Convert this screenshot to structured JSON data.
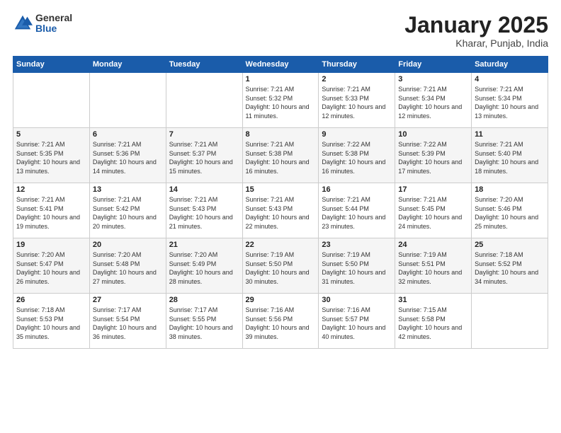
{
  "header": {
    "logo_general": "General",
    "logo_blue": "Blue",
    "month_title": "January 2025",
    "location": "Kharar, Punjab, India"
  },
  "days_of_week": [
    "Sunday",
    "Monday",
    "Tuesday",
    "Wednesday",
    "Thursday",
    "Friday",
    "Saturday"
  ],
  "weeks": [
    [
      {
        "day": "",
        "sunrise": "",
        "sunset": "",
        "daylight": ""
      },
      {
        "day": "",
        "sunrise": "",
        "sunset": "",
        "daylight": ""
      },
      {
        "day": "",
        "sunrise": "",
        "sunset": "",
        "daylight": ""
      },
      {
        "day": "1",
        "sunrise": "Sunrise: 7:21 AM",
        "sunset": "Sunset: 5:32 PM",
        "daylight": "Daylight: 10 hours and 11 minutes."
      },
      {
        "day": "2",
        "sunrise": "Sunrise: 7:21 AM",
        "sunset": "Sunset: 5:33 PM",
        "daylight": "Daylight: 10 hours and 12 minutes."
      },
      {
        "day": "3",
        "sunrise": "Sunrise: 7:21 AM",
        "sunset": "Sunset: 5:34 PM",
        "daylight": "Daylight: 10 hours and 12 minutes."
      },
      {
        "day": "4",
        "sunrise": "Sunrise: 7:21 AM",
        "sunset": "Sunset: 5:34 PM",
        "daylight": "Daylight: 10 hours and 13 minutes."
      }
    ],
    [
      {
        "day": "5",
        "sunrise": "Sunrise: 7:21 AM",
        "sunset": "Sunset: 5:35 PM",
        "daylight": "Daylight: 10 hours and 13 minutes."
      },
      {
        "day": "6",
        "sunrise": "Sunrise: 7:21 AM",
        "sunset": "Sunset: 5:36 PM",
        "daylight": "Daylight: 10 hours and 14 minutes."
      },
      {
        "day": "7",
        "sunrise": "Sunrise: 7:21 AM",
        "sunset": "Sunset: 5:37 PM",
        "daylight": "Daylight: 10 hours and 15 minutes."
      },
      {
        "day": "8",
        "sunrise": "Sunrise: 7:21 AM",
        "sunset": "Sunset: 5:38 PM",
        "daylight": "Daylight: 10 hours and 16 minutes."
      },
      {
        "day": "9",
        "sunrise": "Sunrise: 7:22 AM",
        "sunset": "Sunset: 5:38 PM",
        "daylight": "Daylight: 10 hours and 16 minutes."
      },
      {
        "day": "10",
        "sunrise": "Sunrise: 7:22 AM",
        "sunset": "Sunset: 5:39 PM",
        "daylight": "Daylight: 10 hours and 17 minutes."
      },
      {
        "day": "11",
        "sunrise": "Sunrise: 7:21 AM",
        "sunset": "Sunset: 5:40 PM",
        "daylight": "Daylight: 10 hours and 18 minutes."
      }
    ],
    [
      {
        "day": "12",
        "sunrise": "Sunrise: 7:21 AM",
        "sunset": "Sunset: 5:41 PM",
        "daylight": "Daylight: 10 hours and 19 minutes."
      },
      {
        "day": "13",
        "sunrise": "Sunrise: 7:21 AM",
        "sunset": "Sunset: 5:42 PM",
        "daylight": "Daylight: 10 hours and 20 minutes."
      },
      {
        "day": "14",
        "sunrise": "Sunrise: 7:21 AM",
        "sunset": "Sunset: 5:43 PM",
        "daylight": "Daylight: 10 hours and 21 minutes."
      },
      {
        "day": "15",
        "sunrise": "Sunrise: 7:21 AM",
        "sunset": "Sunset: 5:43 PM",
        "daylight": "Daylight: 10 hours and 22 minutes."
      },
      {
        "day": "16",
        "sunrise": "Sunrise: 7:21 AM",
        "sunset": "Sunset: 5:44 PM",
        "daylight": "Daylight: 10 hours and 23 minutes."
      },
      {
        "day": "17",
        "sunrise": "Sunrise: 7:21 AM",
        "sunset": "Sunset: 5:45 PM",
        "daylight": "Daylight: 10 hours and 24 minutes."
      },
      {
        "day": "18",
        "sunrise": "Sunrise: 7:20 AM",
        "sunset": "Sunset: 5:46 PM",
        "daylight": "Daylight: 10 hours and 25 minutes."
      }
    ],
    [
      {
        "day": "19",
        "sunrise": "Sunrise: 7:20 AM",
        "sunset": "Sunset: 5:47 PM",
        "daylight": "Daylight: 10 hours and 26 minutes."
      },
      {
        "day": "20",
        "sunrise": "Sunrise: 7:20 AM",
        "sunset": "Sunset: 5:48 PM",
        "daylight": "Daylight: 10 hours and 27 minutes."
      },
      {
        "day": "21",
        "sunrise": "Sunrise: 7:20 AM",
        "sunset": "Sunset: 5:49 PM",
        "daylight": "Daylight: 10 hours and 28 minutes."
      },
      {
        "day": "22",
        "sunrise": "Sunrise: 7:19 AM",
        "sunset": "Sunset: 5:50 PM",
        "daylight": "Daylight: 10 hours and 30 minutes."
      },
      {
        "day": "23",
        "sunrise": "Sunrise: 7:19 AM",
        "sunset": "Sunset: 5:50 PM",
        "daylight": "Daylight: 10 hours and 31 minutes."
      },
      {
        "day": "24",
        "sunrise": "Sunrise: 7:19 AM",
        "sunset": "Sunset: 5:51 PM",
        "daylight": "Daylight: 10 hours and 32 minutes."
      },
      {
        "day": "25",
        "sunrise": "Sunrise: 7:18 AM",
        "sunset": "Sunset: 5:52 PM",
        "daylight": "Daylight: 10 hours and 34 minutes."
      }
    ],
    [
      {
        "day": "26",
        "sunrise": "Sunrise: 7:18 AM",
        "sunset": "Sunset: 5:53 PM",
        "daylight": "Daylight: 10 hours and 35 minutes."
      },
      {
        "day": "27",
        "sunrise": "Sunrise: 7:17 AM",
        "sunset": "Sunset: 5:54 PM",
        "daylight": "Daylight: 10 hours and 36 minutes."
      },
      {
        "day": "28",
        "sunrise": "Sunrise: 7:17 AM",
        "sunset": "Sunset: 5:55 PM",
        "daylight": "Daylight: 10 hours and 38 minutes."
      },
      {
        "day": "29",
        "sunrise": "Sunrise: 7:16 AM",
        "sunset": "Sunset: 5:56 PM",
        "daylight": "Daylight: 10 hours and 39 minutes."
      },
      {
        "day": "30",
        "sunrise": "Sunrise: 7:16 AM",
        "sunset": "Sunset: 5:57 PM",
        "daylight": "Daylight: 10 hours and 40 minutes."
      },
      {
        "day": "31",
        "sunrise": "Sunrise: 7:15 AM",
        "sunset": "Sunset: 5:58 PM",
        "daylight": "Daylight: 10 hours and 42 minutes."
      },
      {
        "day": "",
        "sunrise": "",
        "sunset": "",
        "daylight": ""
      }
    ]
  ]
}
